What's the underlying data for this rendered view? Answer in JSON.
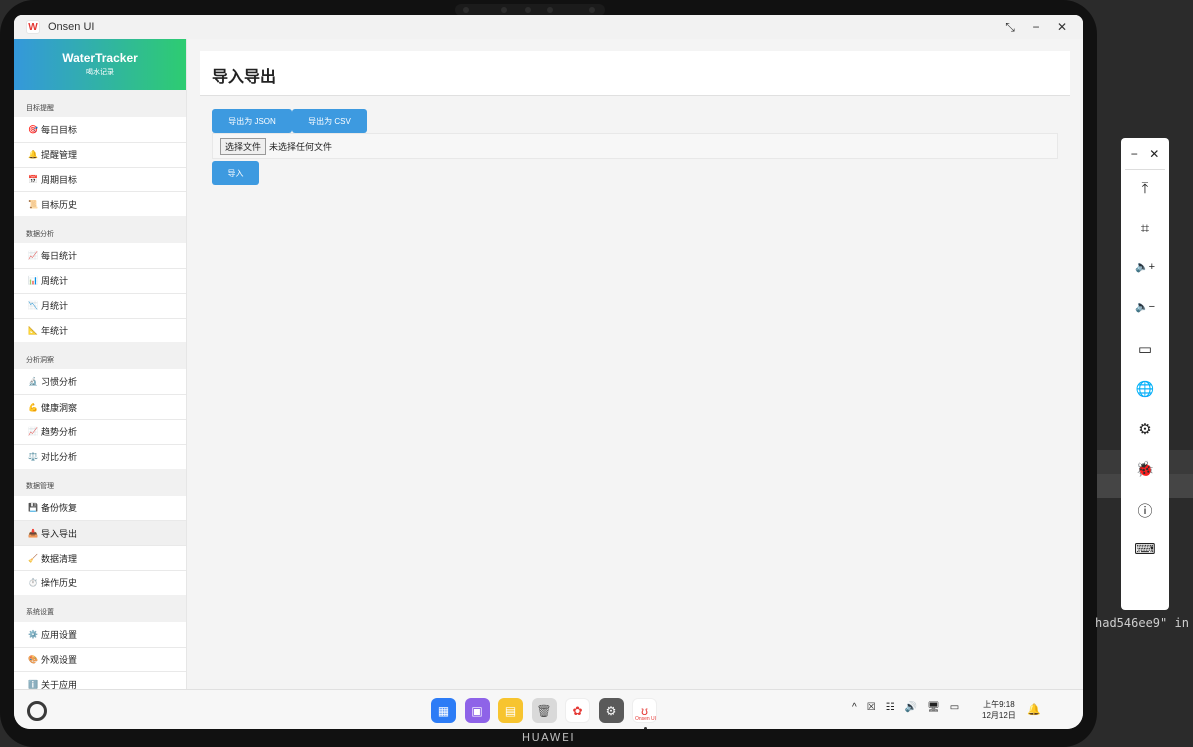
{
  "window": {
    "title": "Onsen UI",
    "logo_text": "W"
  },
  "window_controls": {
    "restore": "⤡",
    "minimize": "−",
    "close": "✕"
  },
  "sidebar": {
    "title": "WaterTracker",
    "subtitle": "喝水记录",
    "sections": [
      {
        "label": "目标提醒",
        "items": [
          {
            "icon": "🎯",
            "label": "每日目标"
          },
          {
            "icon": "🔔",
            "label": "提醒管理"
          },
          {
            "icon": "📅",
            "label": "周期目标"
          },
          {
            "icon": "📜",
            "label": "目标历史"
          }
        ]
      },
      {
        "label": "数据分析",
        "items": [
          {
            "icon": "📈",
            "label": "每日统计"
          },
          {
            "icon": "📊",
            "label": "周统计"
          },
          {
            "icon": "📉",
            "label": "月统计"
          },
          {
            "icon": "📐",
            "label": "年统计"
          }
        ]
      },
      {
        "label": "分析洞察",
        "items": [
          {
            "icon": "🔬",
            "label": "习惯分析"
          },
          {
            "icon": "💪",
            "label": "健康洞察"
          },
          {
            "icon": "📈",
            "label": "趋势分析"
          },
          {
            "icon": "⚖️",
            "label": "对比分析"
          }
        ]
      },
      {
        "label": "数据管理",
        "items": [
          {
            "icon": "💾",
            "label": "备份恢复"
          },
          {
            "icon": "📥",
            "label": "导入导出",
            "active": true
          },
          {
            "icon": "🧹",
            "label": "数据清理"
          },
          {
            "icon": "⏱️",
            "label": "操作历史"
          }
        ]
      },
      {
        "label": "系统设置",
        "items": [
          {
            "icon": "⚙️",
            "label": "应用设置"
          },
          {
            "icon": "🎨",
            "label": "外观设置"
          },
          {
            "icon": "ℹ️",
            "label": "关于应用"
          }
        ]
      }
    ]
  },
  "main": {
    "title": "导入导出",
    "export_json_label": "导出为 JSON",
    "export_csv_label": "导出为 CSV",
    "file_button_label": "选择文件",
    "file_status": "未选择任何文件",
    "import_label": "导入"
  },
  "taskbar": {
    "dock_apps": [
      {
        "name": "app-launcher",
        "glyph": "▦",
        "color": "#2d7cf6"
      },
      {
        "name": "multitask",
        "glyph": "▣",
        "color": "#8e63e8"
      },
      {
        "name": "notes",
        "glyph": "▤",
        "color": "#f7c42f"
      },
      {
        "name": "trash",
        "glyph": "🗑",
        "color": "#d9d9d9"
      },
      {
        "name": "photos",
        "glyph": "✿",
        "color": "#ffffff"
      },
      {
        "name": "settings",
        "glyph": "⚙",
        "color": "#5a5a5a"
      },
      {
        "name": "onsen-app",
        "glyph": "ʊ",
        "color": "#ffffff",
        "label": "Onsen UI"
      }
    ],
    "tray": [
      "^",
      "☒",
      "☷",
      "🔊",
      "🖥",
      "▭"
    ],
    "clock_time": "上午9:18",
    "clock_date": "12月12日",
    "bell": "🔔"
  },
  "device": {
    "brand": "HUAWEI"
  },
  "float_panel": {
    "minimize": "−",
    "close": "✕",
    "icons": [
      "⤒",
      "⌗",
      "🔈+",
      "🔈−",
      "▭",
      "🌐",
      "⚙",
      "🐞",
      "ⓘ",
      "⌨"
    ]
  },
  "background": {
    "code_text": "had546ee9\" in"
  }
}
